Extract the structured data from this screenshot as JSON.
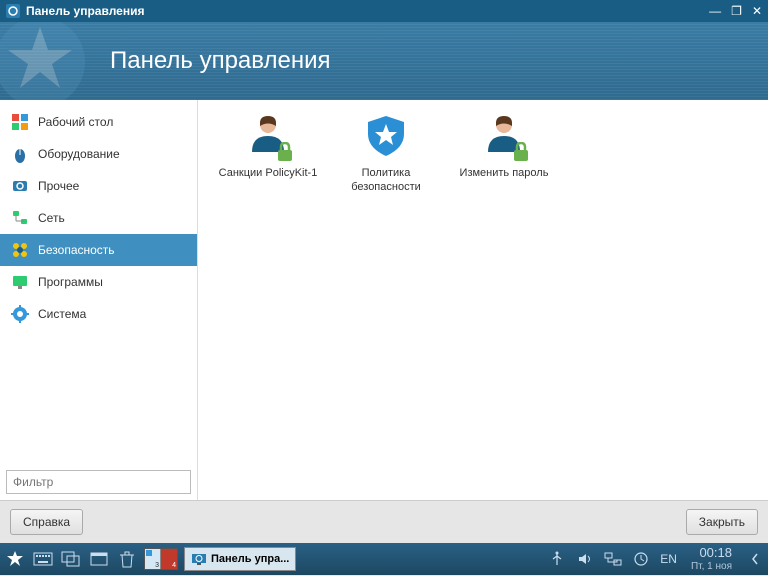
{
  "window": {
    "title": "Панель управления"
  },
  "header": {
    "title": "Панель управления"
  },
  "sidebar": {
    "items": [
      {
        "label": "Рабочий стол"
      },
      {
        "label": "Оборудование"
      },
      {
        "label": "Прочее"
      },
      {
        "label": "Сеть"
      },
      {
        "label": "Безопасность"
      },
      {
        "label": "Программы"
      },
      {
        "label": "Система"
      }
    ],
    "filter_placeholder": "Фильтр"
  },
  "content": {
    "items": [
      {
        "label": "Санкции PolicyKit-1"
      },
      {
        "label": "Политика безопасности"
      },
      {
        "label": "Изменить пароль"
      }
    ]
  },
  "buttons": {
    "help": "Справка",
    "close": "Закрыть"
  },
  "taskbar": {
    "app_label": "Панель упра...",
    "lang": "EN",
    "time": "00:18",
    "date": "Пт, 1 ноя",
    "workspace_a": "3",
    "workspace_b": "4"
  }
}
